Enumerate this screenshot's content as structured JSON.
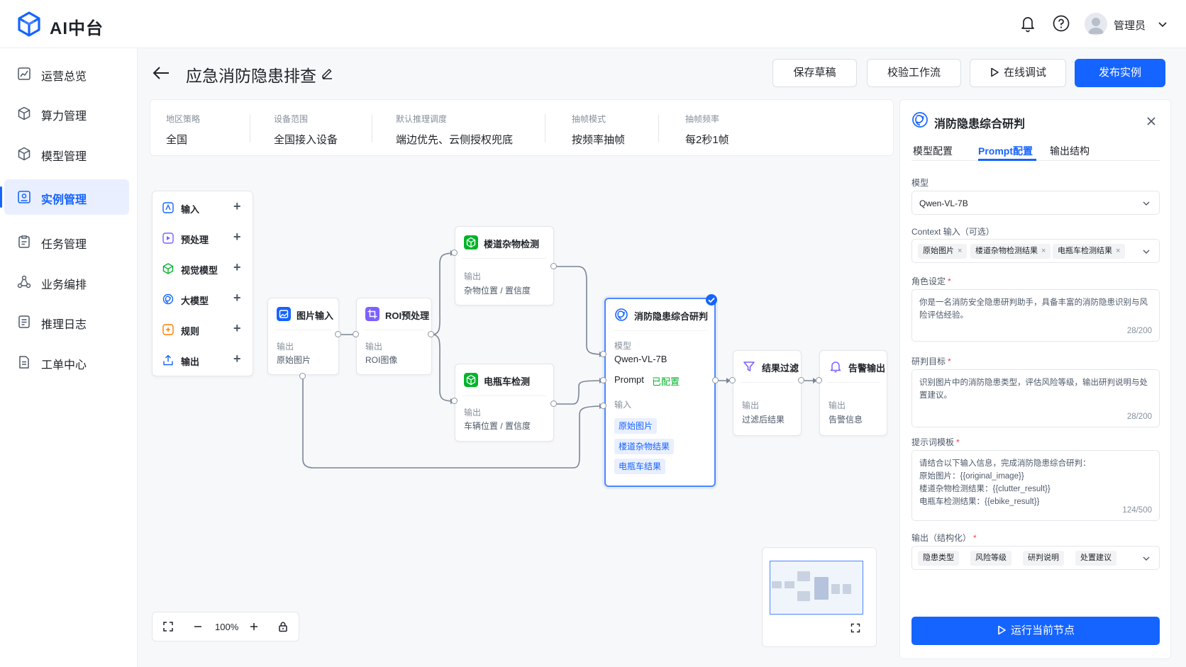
{
  "app": {
    "title": "AI中台",
    "user": "管理员"
  },
  "sidebar": {
    "items": [
      {
        "label": "运营总览",
        "icon": "chart-icon"
      },
      {
        "label": "算力管理",
        "icon": "cube-icon"
      },
      {
        "label": "模型管理",
        "icon": "cube-icon"
      },
      {
        "label": "实例管理",
        "icon": "instance-icon",
        "active": true
      },
      {
        "label": "任务管理",
        "icon": "clipboard-icon"
      },
      {
        "label": "业务编排",
        "icon": "flow-icon"
      },
      {
        "label": "推理日志",
        "icon": "log-icon"
      },
      {
        "label": "工单中心",
        "icon": "document-icon"
      }
    ]
  },
  "header": {
    "title": "应急消防隐患排查",
    "buttons": {
      "save": "保存草稿",
      "validate": "校验工作流",
      "debug": "在线调试",
      "publish": "发布实例"
    }
  },
  "info": [
    {
      "label": "地区策略",
      "value": "全国"
    },
    {
      "label": "设备范围",
      "value": "全国接入设备"
    },
    {
      "label": "默认推理调度",
      "value": "端边优先、云侧授权兜底"
    },
    {
      "label": "抽帧模式",
      "value": "按频率抽帧"
    },
    {
      "label": "抽帧频率",
      "value": "每2秒1帧"
    }
  ],
  "palette": [
    {
      "label": "输入",
      "icon": "input-icon"
    },
    {
      "label": "预处理",
      "icon": "preprocess-icon"
    },
    {
      "label": "视觉模型",
      "icon": "vision-model-icon"
    },
    {
      "label": "大模型",
      "icon": "llm-icon"
    },
    {
      "label": "规则",
      "icon": "rule-icon"
    },
    {
      "label": "输出",
      "icon": "output-icon"
    }
  ],
  "nodes": {
    "image_input": {
      "title": "图片输入",
      "label": "输出",
      "value": "原始图片"
    },
    "roi": {
      "title": "ROI预处理",
      "label": "输出",
      "value": "ROI图像"
    },
    "clutter": {
      "title": "楼道杂物检测",
      "label": "输出",
      "value": "杂物位置 / 置信度"
    },
    "ebike": {
      "title": "电瓶车检测",
      "label": "输出",
      "value": "车辆位置 / 置信度"
    },
    "judge": {
      "title": "消防隐患综合研判",
      "model_label": "模型",
      "model": "Qwen-VL-7B",
      "prompt_label": "Prompt",
      "prompt_status": "已配置",
      "input_label": "输入",
      "inputs": [
        "原始图片",
        "楼道杂物结果",
        "电瓶车结果"
      ]
    },
    "filter": {
      "title": "结果过滤",
      "label": "输出",
      "value": "过滤后结果"
    },
    "alarm": {
      "title": "告警输出",
      "label": "输出",
      "value": "告警信息"
    }
  },
  "zoom": {
    "value": "100%"
  },
  "panel": {
    "title": "消防隐患综合研判",
    "tabs": [
      "模型配置",
      "Prompt配置",
      "输出结构"
    ],
    "active_tab": "Prompt配置",
    "model_label": "模型",
    "model_value": "Qwen-VL-7B",
    "context_label": "Context 输入（可选）",
    "context_chips": [
      "原始图片",
      "楼道杂物检测结果",
      "电瓶车检测结果"
    ],
    "role_label": "角色设定",
    "role_text": "你是一名消防安全隐患研判助手，具备丰富的消防隐患识别与风险评估经验。",
    "role_count": "28/200",
    "goal_label": "研判目标",
    "goal_text": "识别图片中的消防隐患类型，评估风险等级，输出研判说明与处置建议。",
    "goal_count": "28/200",
    "template_label": "提示词模板",
    "template_text": "请结合以下输入信息，完成消防隐患综合研判：\n原始图片：{{original_image}}\n楼道杂物检测结果：{{clutter_result}}\n电瓶车检测结果：{{ebike_result}}",
    "template_count": "124/500",
    "output_label": "输出（结构化）",
    "output_chips": [
      "隐患类型",
      "风险等级",
      "研判说明",
      "处置建议"
    ],
    "run_button": "运行当前节点"
  },
  "colors": {
    "accent": "#1664ff",
    "green": "#00b42a",
    "purple": "#7b61ff",
    "orange": "#ff7d00"
  }
}
